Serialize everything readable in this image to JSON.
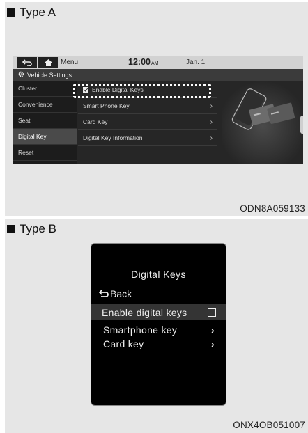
{
  "type_a": {
    "heading": "Type A",
    "topbar": {
      "back_icon": "⮌",
      "home_icon": "⌂",
      "menu_label": "Menu",
      "time": "12:00",
      "ampm": "AM",
      "date": "Jan. 1"
    },
    "settings_title": "Vehicle Settings",
    "sidebar": [
      "Cluster",
      "Convenience",
      "Seat",
      "Digital Key",
      "Reset"
    ],
    "active_sidebar": "Digital Key",
    "enable_label": "Enable Digital Keys",
    "enable_checked": true,
    "menu_items": [
      "Smart Phone Key",
      "Card Key",
      "Digital Key Information"
    ],
    "caption": "ODN8A059133"
  },
  "type_b": {
    "heading": "Type B",
    "title": "Digital Keys",
    "back_label": "Back",
    "enable_label": "Enable digital keys",
    "enable_checked": false,
    "smartphone_label": "Smartphone key",
    "card_label": "Card key",
    "caption": "ONX4OB051007"
  }
}
